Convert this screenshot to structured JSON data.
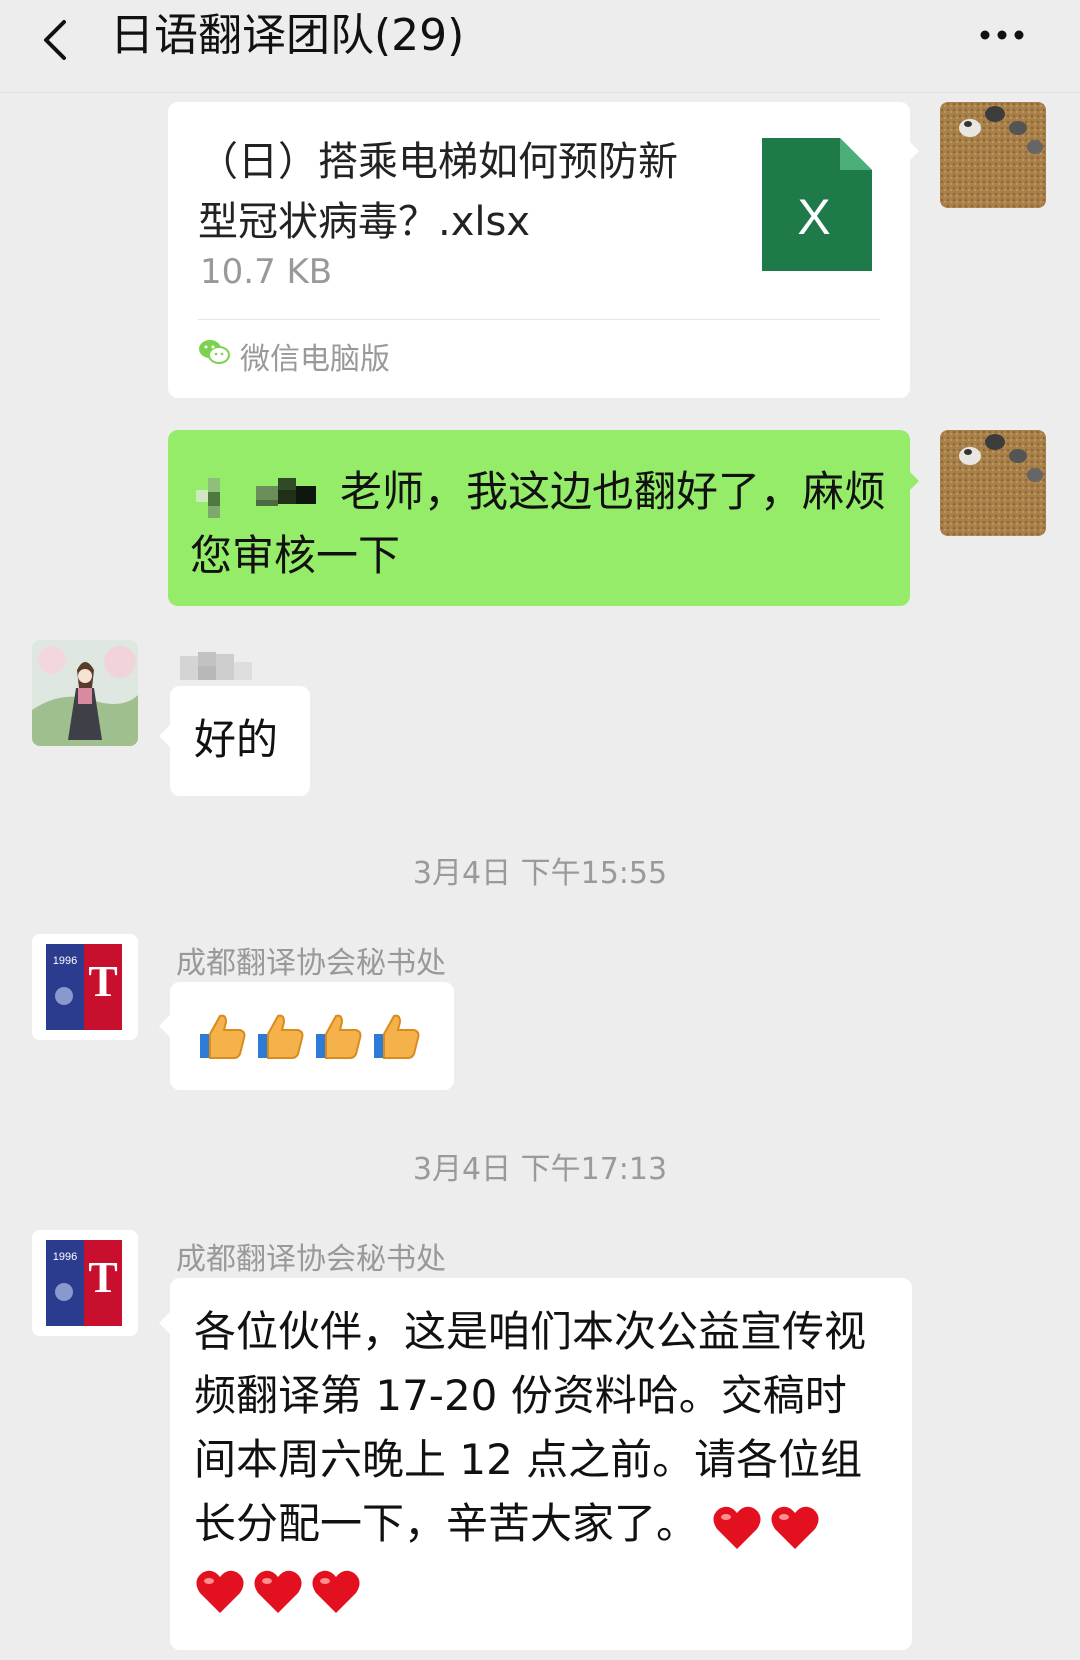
{
  "header": {
    "title": "日语翻译团队(29)",
    "back_icon": "chevron-left-icon",
    "more_icon": "more-icon"
  },
  "messages": {
    "file": {
      "name": "（日）搭乘电梯如何预防新型冠状病毒？.xlsx",
      "size": "10.7 KB",
      "source": "微信电脑版",
      "file_icon_letter": "X",
      "file_icon_color": "#1f7a4a"
    },
    "reply": {
      "text": "老师，我这边也翻好了，麻烦您审核一下"
    },
    "ok": {
      "text": "好的"
    },
    "time1": "3月4日 下午15:55",
    "thumbs": {
      "sender": "成都翻译协会秘书处",
      "emoji_count": 4,
      "emoji_icon": "thumbs-up-icon"
    },
    "time2": "3月4日 下午17:13",
    "notice": {
      "sender": "成都翻译协会秘书处",
      "text": "各位伙伴，这是咱们本次公益宣传视频翻译第 17-20 份资料哈。交稿时间本周六晚上 12 点之前。请各位组长分配一下，辛苦大家了。",
      "heart_count": 5,
      "heart_icon": "red-heart-icon"
    }
  },
  "colors": {
    "background": "#ededed",
    "green_bubble": "#95ec69",
    "white_bubble": "#ffffff",
    "excel_green": "#1f7a4a"
  }
}
